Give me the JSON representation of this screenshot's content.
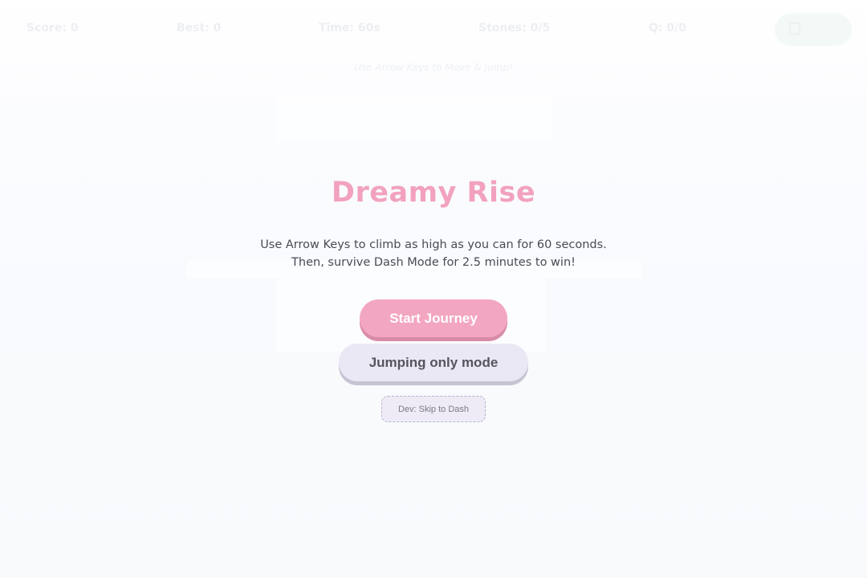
{
  "hud": {
    "score": "Score: 0",
    "best": "Best: 0",
    "time": "Time: 60s",
    "stones": "Stones: 0/5",
    "questions": "Q: 0/0",
    "hint": "Use Arrow Keys to Move & Jump!",
    "pause_icon": "pause-icon"
  },
  "overlay": {
    "title": "Dreamy Rise",
    "description_line1": "Use Arrow Keys to climb as high as you can for 60 seconds.",
    "description_line2": "Then, survive Dash Mode for 2.5 minutes to win!",
    "start_label": "Start Journey",
    "jump_mode_label": "Jumping only mode",
    "dev_label": "Dev: Skip to Dash"
  },
  "colors": {
    "title": "#f2a2be",
    "start_button": "#f3a6c1",
    "secondary_button": "#ebe8f5",
    "text": "#4a4a55"
  }
}
